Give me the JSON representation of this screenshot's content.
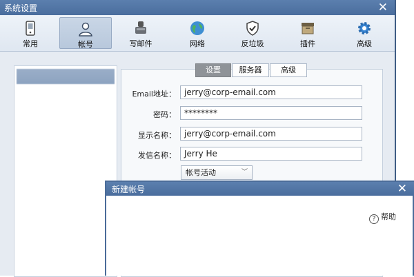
{
  "window": {
    "title": "系统设置",
    "close_glyph": "✕"
  },
  "toolbar": {
    "items": [
      {
        "label": "常用",
        "icon": "phone-icon"
      },
      {
        "label": "帐号",
        "icon": "user-icon"
      },
      {
        "label": "写邮件",
        "icon": "pen-icon"
      },
      {
        "label": "网络",
        "icon": "globe-icon"
      },
      {
        "label": "反垃圾",
        "icon": "shield-icon"
      },
      {
        "label": "插件",
        "icon": "box-icon"
      },
      {
        "label": "高级",
        "icon": "gear-icon"
      }
    ],
    "active_index": 1
  },
  "tabs": [
    {
      "label": "设置",
      "active": true
    },
    {
      "label": "服务器",
      "active": false
    },
    {
      "label": "高级",
      "active": false
    }
  ],
  "form": {
    "email_label": "Email地址：",
    "email_value": "jerry@corp-email.com",
    "password_label": "密码：",
    "password_value": "********",
    "display_name_label": "显示名称：",
    "display_name_value": "jerry@corp-email.com",
    "sender_name_label": "发信名称：",
    "sender_name_value": "Jerry He",
    "account_status_value": "帐号活动"
  },
  "new_account_dialog": {
    "title": "新建帐号",
    "close_glyph": "✕",
    "help_label": "帮助"
  }
}
